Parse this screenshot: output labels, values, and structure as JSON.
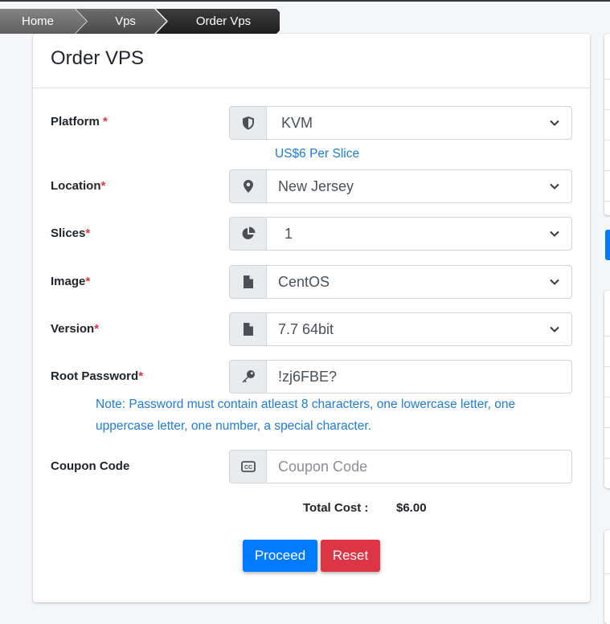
{
  "breadcrumb": {
    "home": "Home",
    "vps": "Vps",
    "current": "Order Vps"
  },
  "card": {
    "title": "Order VPS"
  },
  "form": {
    "platform": {
      "label": "Platform",
      "required": "*",
      "value": "KVM",
      "hint": "US$6 Per Slice",
      "icon": "shield-icon"
    },
    "location": {
      "label": "Location",
      "required": "*",
      "value": "New Jersey",
      "icon": "map-marker-icon"
    },
    "slices": {
      "label": "Slices",
      "required": "*",
      "value": "1",
      "icon": "pie-chart-icon"
    },
    "image": {
      "label": "Image",
      "required": "*",
      "value": "CentOS",
      "icon": "file-icon"
    },
    "version": {
      "label": "Version",
      "required": "*",
      "value": "7.7 64bit",
      "icon": "file-icon"
    },
    "root_password": {
      "label": "Root Password",
      "required": "*",
      "value": "!zj6FBE?",
      "icon": "key-icon"
    },
    "password_note_line1": "Note: Password must contain atleast 8 characters, one lowercase letter, one",
    "password_note_line2": "uppercase letter, one number, a special character.",
    "coupon": {
      "label": "Coupon Code",
      "placeholder": "Coupon Code",
      "value": "",
      "icon": "closed-caption-icon"
    }
  },
  "total": {
    "label": "Total Cost :",
    "value": "$6.00"
  },
  "buttons": {
    "proceed": "Proceed",
    "reset": "Reset"
  },
  "colors": {
    "primary": "#007bff",
    "danger": "#dc3545",
    "hint": "#1e7bd8",
    "required": "#dc3545"
  }
}
